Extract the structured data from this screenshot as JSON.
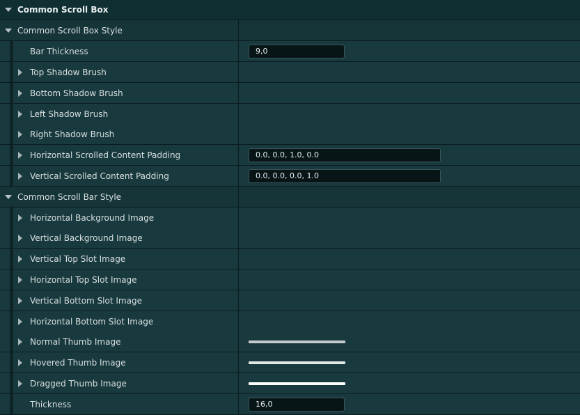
{
  "section": {
    "title": "Common Scroll Box"
  },
  "scroll_box_style": {
    "label": "Common Scroll Box Style",
    "bar_thickness": {
      "label": "Bar Thickness",
      "value": "9,0"
    },
    "top_shadow_brush": {
      "label": "Top Shadow Brush"
    },
    "bottom_shadow_brush": {
      "label": "Bottom Shadow Brush"
    },
    "left_shadow_brush": {
      "label": "Left Shadow Brush"
    },
    "right_shadow_brush": {
      "label": "Right Shadow Brush"
    },
    "horizontal_padding": {
      "label": "Horizontal Scrolled Content Padding",
      "value": "0.0, 0.0, 1.0, 0.0"
    },
    "vertical_padding": {
      "label": "Vertical Scrolled Content Padding",
      "value": "0.0, 0.0, 0.0, 1.0"
    }
  },
  "scroll_bar_style": {
    "label": "Common Scroll Bar Style",
    "horizontal_background_image": {
      "label": "Horizontal Background Image"
    },
    "vertical_background_image": {
      "label": "Vertical Background Image"
    },
    "vertical_top_slot_image": {
      "label": "Vertical Top Slot Image"
    },
    "horizontal_top_slot_image": {
      "label": "Horizontal Top Slot Image"
    },
    "vertical_bottom_slot_image": {
      "label": "Vertical Bottom Slot Image"
    },
    "horizontal_bottom_slot_image": {
      "label": "Horizontal Bottom Slot Image"
    },
    "normal_thumb_image": {
      "label": "Normal Thumb Image",
      "color": "#c4cacc"
    },
    "hovered_thumb_image": {
      "label": "Hovered Thumb Image",
      "color": "#e2e6e7"
    },
    "dragged_thumb_image": {
      "label": "Dragged Thumb Image",
      "color": "#ffffff"
    },
    "thickness": {
      "label": "Thickness",
      "value": "16,0"
    }
  },
  "icons": {
    "expanded": "chevron-down-icon",
    "collapsed": "chevron-right-icon"
  }
}
